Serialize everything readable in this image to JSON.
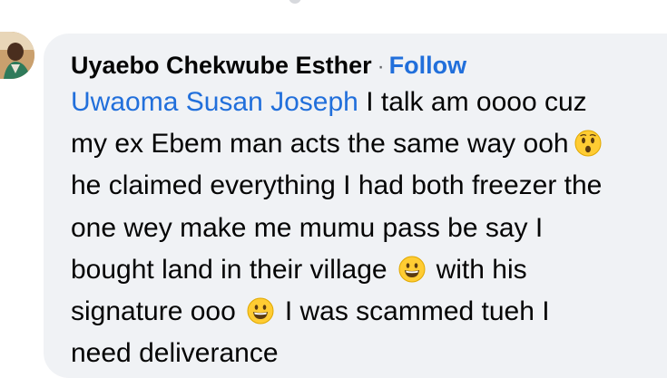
{
  "comment": {
    "author": "Uyaebo Chekwube Esther",
    "separator": "·",
    "follow_label": "Follow",
    "mention": "Uwaoma Susan Joseph",
    "lines": [
      " I talk am oooo cuz",
      "my ex Ebem man acts the same way ooh",
      "he claimed everything I had both freezer the",
      "one wey make me mumu pass be say I",
      "bought land in their village",
      "with his",
      "signature ooo",
      "I was scammed tueh I",
      "need deliverance"
    ],
    "emojis": [
      "astonished-face",
      "grinning-face",
      "grinning-face"
    ]
  },
  "colors": {
    "bubble": "#f0f2f5",
    "link": "#216fdb",
    "text": "#050505",
    "emoji_yellow": "#ffcc33"
  }
}
